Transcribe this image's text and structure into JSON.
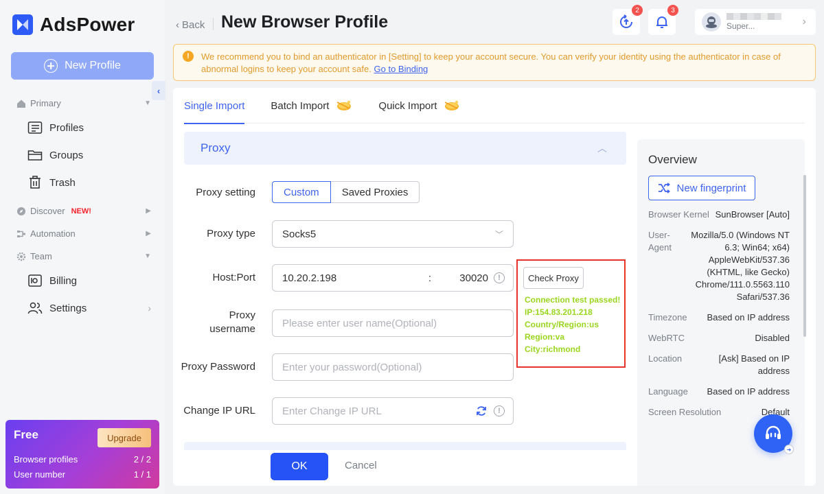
{
  "app": {
    "name": "AdsPower",
    "page_title": "New Browser Profile",
    "back_label": "Back",
    "accent": "#3d63f1"
  },
  "sidebar": {
    "new_profile_label": "New Profile",
    "sections": [
      {
        "label": "Primary",
        "icon": "home-icon"
      },
      {
        "label": "Discover",
        "badge": "NEW!",
        "icon": "compass-icon"
      },
      {
        "label": "Automation",
        "icon": "automation-icon"
      },
      {
        "label": "Team",
        "icon": "gear-icon"
      }
    ],
    "items": [
      {
        "label": "Profiles",
        "icon": "profiles-icon"
      },
      {
        "label": "Groups",
        "icon": "folder-icon"
      },
      {
        "label": "Trash",
        "icon": "trash-icon"
      },
      {
        "label": "Billing",
        "icon": "billing-icon"
      },
      {
        "label": "Settings",
        "icon": "users-icon"
      }
    ],
    "plan": {
      "name": "Free",
      "upgrade_label": "Upgrade",
      "rows": [
        {
          "label": "Browser profiles",
          "value": "2 / 2"
        },
        {
          "label": "User number",
          "value": "1 / 1"
        }
      ]
    }
  },
  "header": {
    "sync_badge": "2",
    "notif_badge": "3",
    "user_name": "Super..."
  },
  "notice": {
    "text": "We recommend you to bind an authenticator in [Setting] to keep your account secure. You can verify your identity using the authenticator in case of abnormal logins to keep your account safe.",
    "link": "Go to Binding"
  },
  "tabs": [
    {
      "label": "Single Import",
      "active": true
    },
    {
      "label": "Batch Import"
    },
    {
      "label": "Quick Import"
    }
  ],
  "proxy": {
    "section_title": "Proxy",
    "setting_label": "Proxy setting",
    "setting_options": [
      "Custom",
      "Saved Proxies"
    ],
    "type_label": "Proxy type",
    "type_value": "Socks5",
    "host_label": "Host:Port",
    "host_value": "10.20.2.198",
    "port_separator": ":",
    "port_value": "30020",
    "username_label": "Proxy username",
    "username_placeholder": "Please enter user name(Optional)",
    "password_label": "Proxy Password",
    "password_placeholder": "Enter your password(Optional)",
    "change_ip_label": "Change IP URL",
    "change_ip_placeholder": "Enter Change IP URL",
    "check_button": "Check Proxy",
    "check_result": [
      "Connection test passed!",
      "IP:154.83.201.218",
      "Country/Region:us",
      "Region:va",
      "City:richmond"
    ]
  },
  "footer": {
    "ok_label": "OK",
    "cancel_label": "Cancel"
  },
  "overview": {
    "title": "Overview",
    "new_fingerprint_label": "New fingerprint",
    "rows": [
      {
        "key": "Browser Kernel",
        "value": "SunBrowser [Auto]"
      },
      {
        "key": "User-Agent",
        "value": "Mozilla/5.0 (Windows NT 6.3; Win64; x64) AppleWebKit/537.36 (KHTML, like Gecko) Chrome/111.0.5563.110 Safari/537.36"
      },
      {
        "key": "Timezone",
        "value": "Based on IP address"
      },
      {
        "key": "WebRTC",
        "value": "Disabled"
      },
      {
        "key": "Location",
        "value": "[Ask] Based on IP address"
      },
      {
        "key": "Language",
        "value": "Based on IP address"
      },
      {
        "key": "Screen Resolution",
        "value": "Default"
      }
    ]
  }
}
